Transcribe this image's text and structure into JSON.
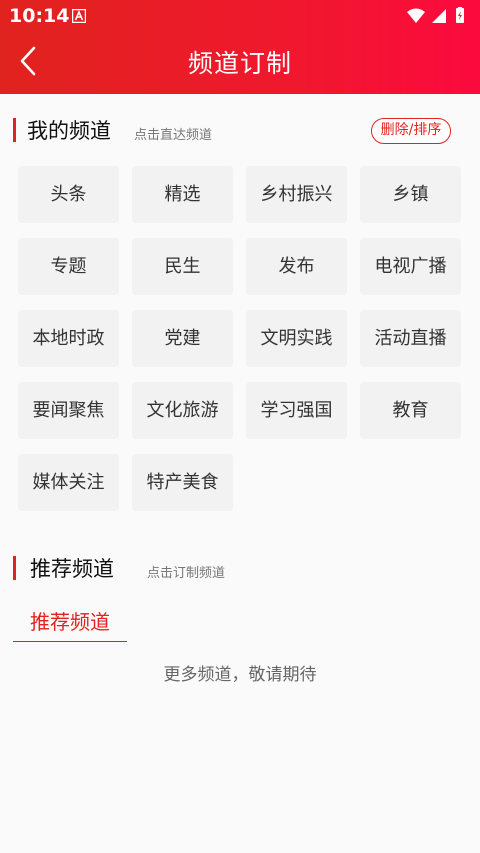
{
  "status_bar": {
    "time": "10:14"
  },
  "header": {
    "title": "频道订制"
  },
  "my_channels": {
    "title": "我的频道",
    "hint": "点击直达频道",
    "edit_label": "删除/排序",
    "items": [
      "头条",
      "精选",
      "乡村振兴",
      "乡镇",
      "专题",
      "民生",
      "发布",
      "电视广播",
      "本地时政",
      "党建",
      "文明实践",
      "活动直播",
      "要闻聚焦",
      "文化旅游",
      "学习强国",
      "教育",
      "媒体关注",
      "特产美食"
    ]
  },
  "recommended": {
    "title": "推荐频道",
    "hint": "点击订制频道",
    "tab_label": "推荐频道",
    "empty_text": "更多频道，敬请期待"
  },
  "colors": {
    "accent": "#e0231e",
    "tile_bg": "#f2f2f2"
  }
}
